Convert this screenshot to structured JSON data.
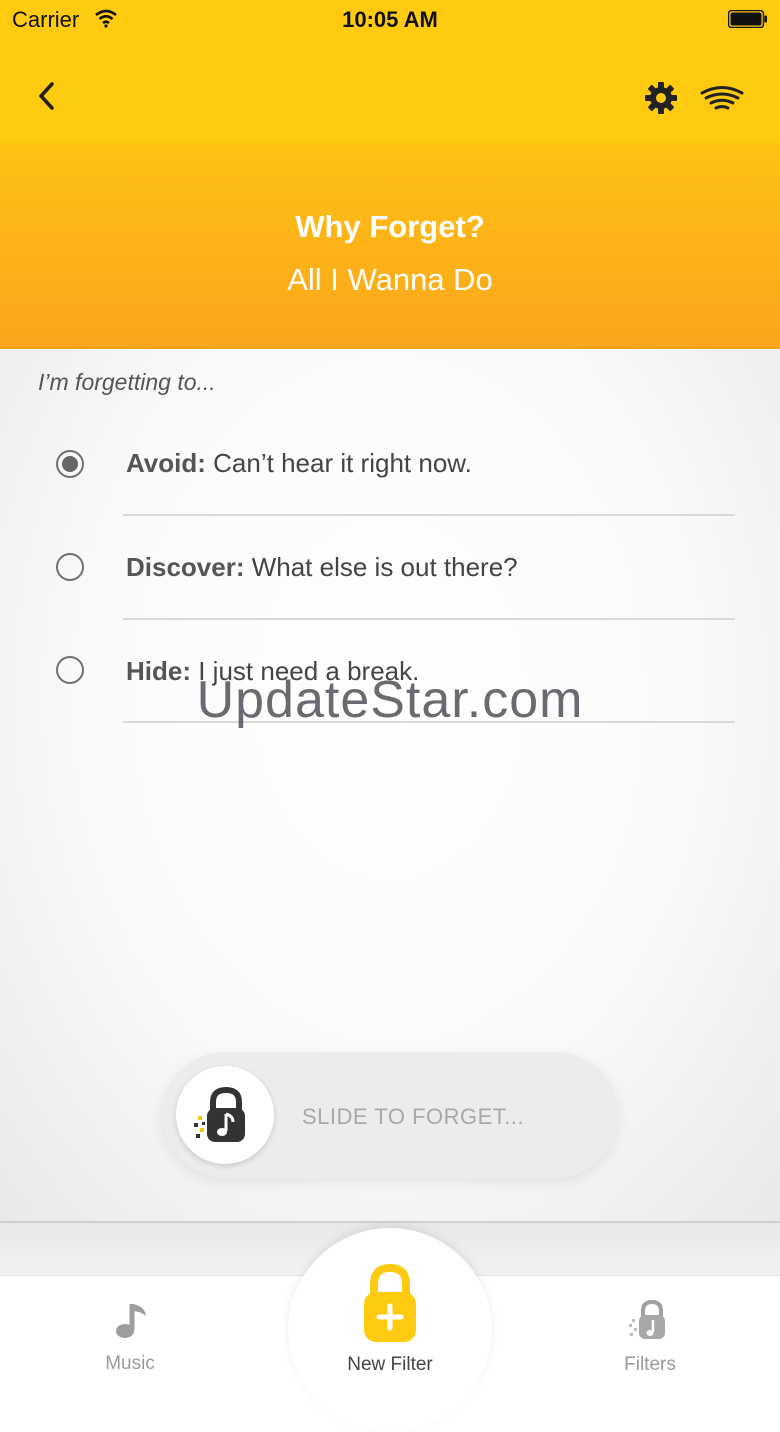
{
  "status": {
    "carrier": "Carrier",
    "time": "10:05 AM"
  },
  "nav": {
    "back_icon": "chevron-left-icon",
    "settings_icon": "gear-icon",
    "signal_icon": "broadcast-icon"
  },
  "header": {
    "title": "Why Forget?",
    "subtitle": "All I Wanna Do"
  },
  "prompt": "I’m forgetting to...",
  "options": [
    {
      "bold": "Avoid:",
      "text": " Can’t hear it right now.",
      "selected": true
    },
    {
      "bold": "Discover:",
      "text": " What else is out there?",
      "selected": false
    },
    {
      "bold": "Hide:",
      "text": " I just need a break.",
      "selected": false
    }
  ],
  "watermark": "UpdateStar.com",
  "slider": {
    "label": "SLIDE TO FORGET..."
  },
  "tabs": [
    {
      "label": "Music",
      "icon": "music-note-icon",
      "active": false
    },
    {
      "label": "New Filter",
      "icon": "lock-plus-icon",
      "active": true
    },
    {
      "label": "Filters",
      "icon": "lock-music-icon",
      "active": false
    }
  ],
  "colors": {
    "brand_yellow": "#fecb10",
    "header_orange": "#fba51c"
  }
}
